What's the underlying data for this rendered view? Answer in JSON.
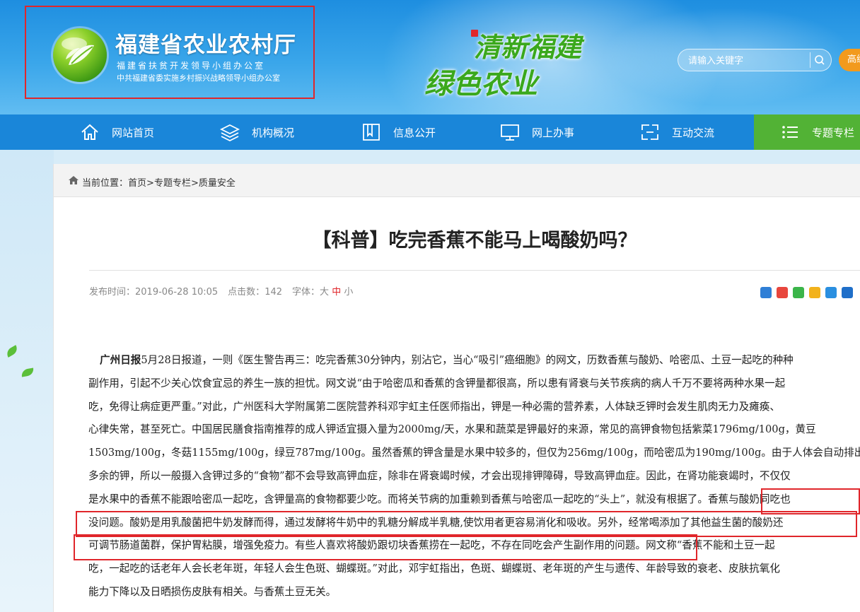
{
  "header": {
    "site_name": "福建省农业农村厅",
    "sub_line_1": "福建省扶贫开发领导小组办公室",
    "sub_line_2": "中共福建省委实施乡村振兴战略领导小组办公室",
    "slogan_line_1": "清新福建",
    "slogan_line_2": "绿色农业",
    "search_placeholder": "请输入关键字",
    "search_icon": "search-icon",
    "advanced_label": "高级"
  },
  "nav": {
    "items": [
      {
        "label": "网站首页",
        "icon": "home-icon"
      },
      {
        "label": "机构概况",
        "icon": "layers-icon"
      },
      {
        "label": "信息公开",
        "icon": "bookmark-icon"
      },
      {
        "label": "网上办事",
        "icon": "monitor-icon"
      },
      {
        "label": "互动交流",
        "icon": "exchange-icon"
      },
      {
        "label": "专题专栏",
        "icon": "list-icon"
      }
    ]
  },
  "breadcrumb": {
    "prefix": "当前位置：",
    "items": [
      "首页",
      "专题专栏",
      "质量安全"
    ],
    "separator": ">"
  },
  "article": {
    "title": "【科普】吃完香蕉不能马上喝酸奶吗？",
    "meta": {
      "publish_label": "发布时间：",
      "publish_time": "2019-06-28 10:05",
      "clicks_label": "点击数：",
      "clicks": "142",
      "font_label": "字体：",
      "font_sizes": [
        "大",
        "中",
        "小"
      ]
    },
    "source": "广州日报",
    "lines": [
      "5月28日报道，一则《医生警告再三：吃完香蕉30分钟内，别沾它，当心“吸引”癌细胞》的网文，历数香蕉与酸奶、哈密瓜、土豆一起吃的种种",
      "副作用，引起不少关心饮食宜忌的养生一族的担忧。网文说“由于哈密瓜和香蕉的含钾量都很高，所以患有肾衰与关节疾病的病人千万不要将两种水果一起",
      "吃，免得让病症更严重。”对此，广州医科大学附属第二医院营养科邓宇虹主任医师指出，钾是一种必需的营养素，人体缺乏钾时会发生肌肉无力及瘫痪、",
      "心律失常，甚至死亡。中国居民膳食指南推荐的成人钾适宜摄入量为2000mg/天，水果和蔬菜是钾最好的来源，常见的高钾食物包括紫菜1796mg/100g，黄豆",
      "1503mg/100g，冬菇1155mg/100g，绿豆787mg/100g。虽然香蕉的钾含量是水果中较多的，但仅为256mg/100g，而哈密瓜为190mg/100g。由于人体会自动排出",
      "多余的钾，所以一般摄入含钾过多的“食物”都不会导致高钾血症，除非在肾衰竭时候，才会出现排钾障碍，导致高钾血症。因此，在肾功能衰竭时，不仅仅",
      "是水果中的香蕉不能跟哈密瓜一起吃，含钾量高的食物都要少吃。而将关节病的加重赖到香蕉与哈密瓜一起吃的“头上”，就没有根据了。香蕉与酸奶同吃也",
      "没问题。酸奶是用乳酸菌把牛奶发酵而得，通过发酵将牛奶中的乳糖分解成半乳糖,使饮用者更容易消化和吸收。另外，经常喝添加了其他益生菌的酸奶还",
      "可调节肠道菌群，保护胃粘膜，增强免疫力。有些人喜欢将酸奶跟切块香蕉捞在一起吃，不存在同吃会产生副作用的问题。网文称“香蕉不能和土豆一起",
      "吃，一起吃的话老年人会长老年斑，年轻人会生色斑、蝴蝶斑。”对此，邓宇虹指出，色斑、蝴蝶斑、老年斑的产生与遗传、年龄导致的衰老、皮肤抗氧化",
      "能力下降以及日晒损伤皮肤有相关。与香蕉土豆无关。"
    ]
  },
  "colors": {
    "header_blue": "#1e8ee0",
    "nav_blue": "#1a86d9",
    "nav_special_green": "#52b235",
    "highlight_red": "#e0262b",
    "advanced_orange": "#f29a1d"
  }
}
